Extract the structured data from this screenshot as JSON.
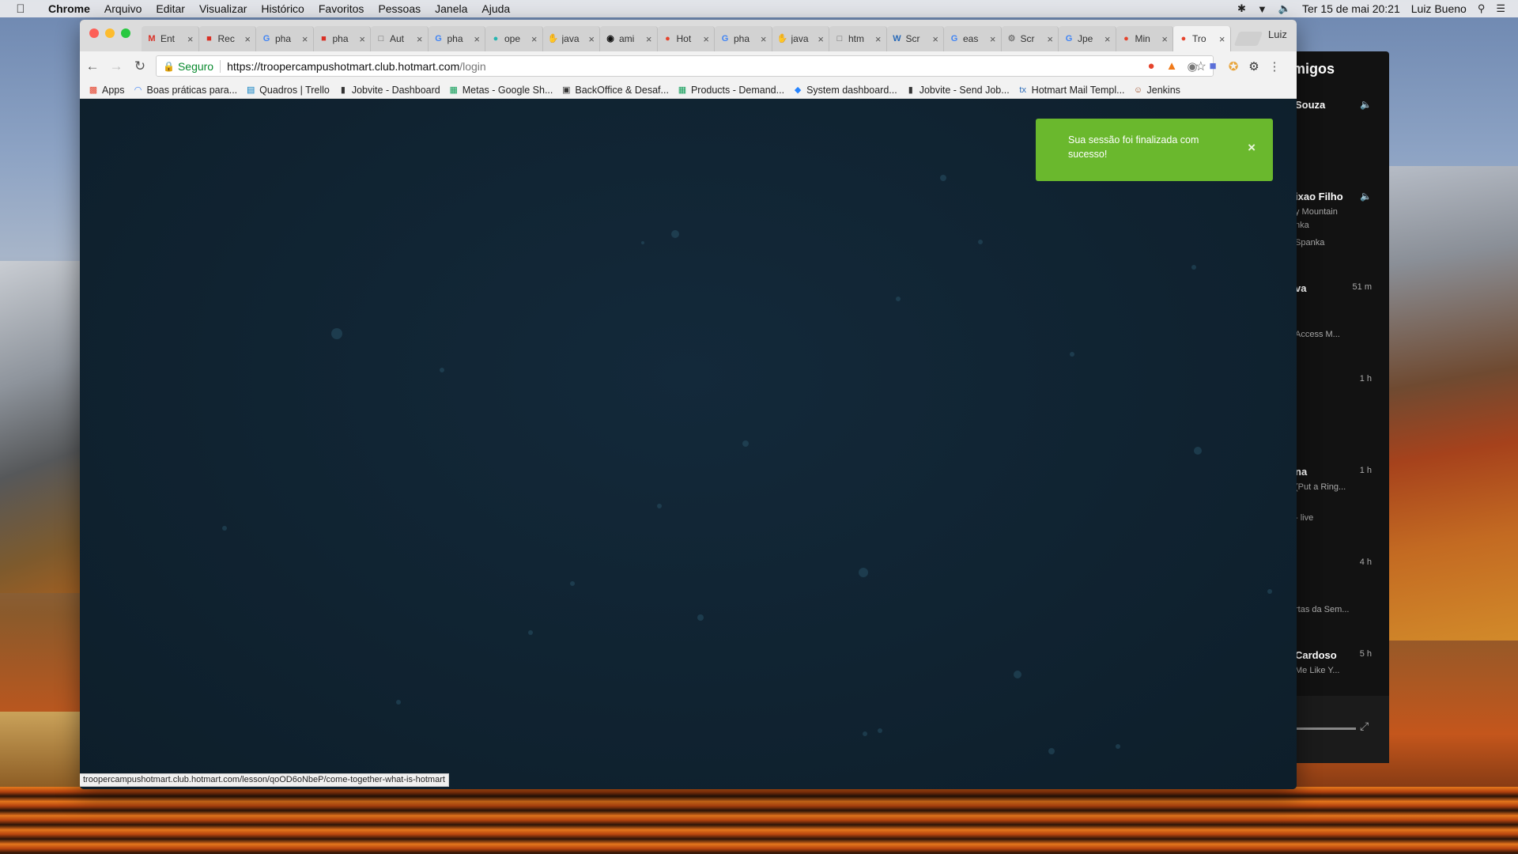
{
  "menubar": {
    "app": "Chrome",
    "items": [
      "Arquivo",
      "Editar",
      "Visualizar",
      "Histórico",
      "Favoritos",
      "Pessoas",
      "Janela",
      "Ajuda"
    ],
    "datetime": "Ter 15 de mai  20:21",
    "user": "Luiz Bueno"
  },
  "tabs": [
    {
      "label": "Ent",
      "icon": "gmail-icon"
    },
    {
      "label": "Rec",
      "icon": "red-icon"
    },
    {
      "label": "pha",
      "icon": "google-icon"
    },
    {
      "label": "pha",
      "icon": "red-icon"
    },
    {
      "label": "Aut",
      "icon": "page-icon"
    },
    {
      "label": "pha",
      "icon": "google-icon"
    },
    {
      "label": "ope",
      "icon": "teal-icon"
    },
    {
      "label": "java",
      "icon": "hand-icon"
    },
    {
      "label": "ami",
      "icon": "github-icon"
    },
    {
      "label": "Hot",
      "icon": "hotmart-icon"
    },
    {
      "label": "pha",
      "icon": "google-icon"
    },
    {
      "label": "java",
      "icon": "hand-icon"
    },
    {
      "label": "htm",
      "icon": "page-icon"
    },
    {
      "label": "Scr",
      "icon": "w3-icon"
    },
    {
      "label": "eas",
      "icon": "google-icon"
    },
    {
      "label": "Scr",
      "icon": "gear-icon"
    },
    {
      "label": "Jpe",
      "icon": "google-icon"
    },
    {
      "label": "Min",
      "icon": "hotmart-icon"
    },
    {
      "label": "Tro",
      "icon": "hotmart-icon",
      "active": true
    }
  ],
  "profile_name": "Luiz",
  "omnibox": {
    "secure_label": "Seguro",
    "url_host": "https://troopercampushotmart.club.hotmart.com",
    "url_path": "/login"
  },
  "bookmarks": [
    {
      "label": "Apps",
      "icon": "apps-grid-icon"
    },
    {
      "label": "Boas práticas para...",
      "icon": "loading-icon"
    },
    {
      "label": "Quadros | Trello",
      "icon": "trello-icon"
    },
    {
      "label": "Jobvite - Dashboard",
      "icon": "jobvite-icon"
    },
    {
      "label": "Metas - Google Sh...",
      "icon": "sheets-icon"
    },
    {
      "label": "BackOffice & Desaf...",
      "icon": "board-icon"
    },
    {
      "label": "Products - Demand...",
      "icon": "sheets-icon"
    },
    {
      "label": "System dashboard...",
      "icon": "jira-icon"
    },
    {
      "label": "Jobvite - Send Job...",
      "icon": "jobvite-icon"
    },
    {
      "label": "Hotmart Mail Templ...",
      "icon": "tx-icon"
    },
    {
      "label": "Jenkins",
      "icon": "jenkins-icon"
    }
  ],
  "toast": {
    "message": "Sua sessão foi finalizada com sucesso!",
    "close_glyph": "×",
    "color": "#6ab82d"
  },
  "status_url": "troopercampushotmart.club.hotmart.com/lesson/qoOD6oNbeP/come-together-what-is-hotmart",
  "friends_panel": {
    "title": "migos",
    "entries": [
      {
        "name": "Souza",
        "sub": "",
        "sub2": "",
        "time": ""
      },
      {
        "name": "ixao Filho",
        "sub": "y Mountain",
        "sub2": "nka",
        "sub3": "Spanka",
        "time": ""
      },
      {
        "name": "va",
        "sub": "",
        "sub2": "Access M...",
        "time": "51 m"
      },
      {
        "name": "",
        "sub": "",
        "sub2": "",
        "time": "1 h"
      },
      {
        "name": "na",
        "sub": "(Put a Ring...",
        "sub2": "- live",
        "time": "1 h"
      },
      {
        "name": "",
        "sub": "",
        "sub2": "rtas da Sem...",
        "time": "4 h"
      },
      {
        "name": "Cardoso",
        "sub": "Me Like Y...",
        "sub2": "",
        "time": "5 h"
      }
    ]
  }
}
